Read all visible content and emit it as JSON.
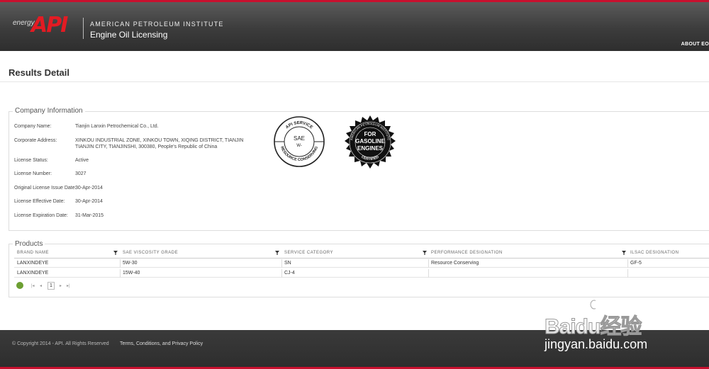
{
  "header": {
    "logo_energy": "energy",
    "logo_api": "API",
    "org_name": "AMERICAN PETROLEUM INSTITUTE",
    "app_name": "Engine Oil Licensing",
    "nav_about": "ABOUT EO"
  },
  "page": {
    "title": "Results Detail"
  },
  "company": {
    "legend": "Company Information",
    "fields": [
      {
        "label": "Company Name:",
        "value": "Tianjin Lanxin Petrochemical Co., Ltd."
      },
      {
        "label": "Corporate Address:",
        "value": "XINKOU INDUSTRIAL ZONE, XINKOU TOWN, XIQING DISTRICT, TIANJIN TIANJIN CITY, TIANJINSHI, 300380, People's Republic of China"
      },
      {
        "label": "License Status:",
        "value": "Active"
      },
      {
        "label": "License Number:",
        "value": "3027"
      },
      {
        "label": "Original License Issue Date:",
        "value": "30-Apr-2014"
      },
      {
        "label": "License Effective Date:",
        "value": "30-Apr-2014"
      },
      {
        "label": "License Expiration Date:",
        "value": "31-Mar-2015"
      }
    ],
    "seals": {
      "donut_top": "API SERVICE",
      "donut_mid1": "SAE",
      "donut_mid2": "W-",
      "donut_bottom": "RESOURCE CONSERVING",
      "starburst_ring_top": "AMERICAN PETROLEUM INSTITUTE",
      "starburst_ring_bottom": "CERTIFIED",
      "starburst_line1": "FOR",
      "starburst_line2": "GASOLINE",
      "starburst_line3": "ENGINES"
    }
  },
  "products": {
    "legend": "Products",
    "columns": [
      "BRAND NAME",
      "SAE VISCOSITY GRADE",
      "SERVICE CATEGORY",
      "PERFORMANCE DESIGNATION",
      "ILSAC DESIGNATION"
    ],
    "rows": [
      [
        "LANXINDEYE",
        "5W-30",
        "SN",
        "Resource Conserving",
        "GF-5"
      ],
      [
        "LANXINDEYE",
        "15W-40",
        "CJ-4",
        "",
        ""
      ]
    ],
    "pager": {
      "current_page": "1"
    }
  },
  "footer": {
    "copyright": "© Copyright 2014 - API. All Rights Reserved",
    "terms": "Terms, Conditions, and Privacy Policy"
  },
  "watermark": {
    "line1": "Baidu经验",
    "line2": "jingyan.baidu.com"
  },
  "colors": {
    "brand_red": "#c8102e",
    "header_gray": "#3c3c3c",
    "pager_green": "#6c9f32"
  }
}
